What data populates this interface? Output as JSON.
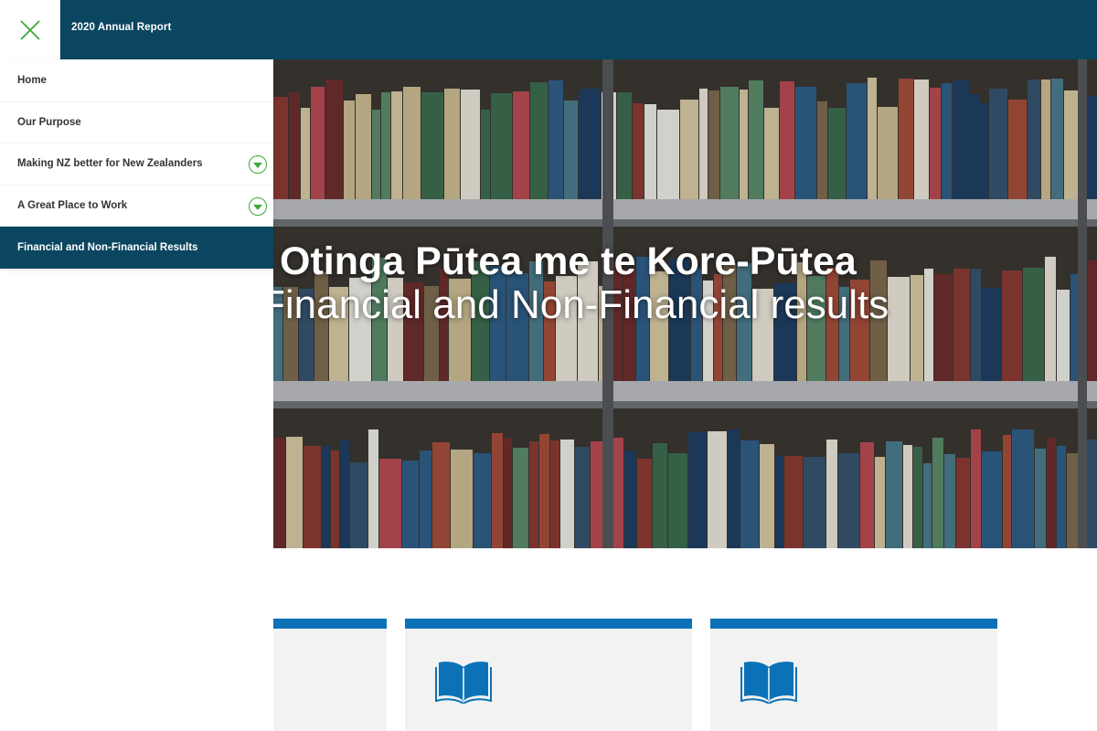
{
  "header": {
    "report_title": "2020 Annual Report"
  },
  "menu": {
    "items": [
      {
        "label": "Home",
        "expandable": false,
        "active": false
      },
      {
        "label": "Our Purpose",
        "expandable": false,
        "active": false
      },
      {
        "label": "Making NZ better for New Zealanders",
        "expandable": true,
        "active": false
      },
      {
        "label": "A Great Place to Work",
        "expandable": true,
        "active": false
      },
      {
        "label": "Financial and Non-Financial Results",
        "expandable": false,
        "active": true
      }
    ]
  },
  "hero": {
    "title_maori": "Otinga Pūtea me te Kore-Pūtea",
    "title_english": "Financial and Non-Financial results"
  },
  "colors": {
    "header_bg": "#0b4660",
    "accent_green": "#3aa935",
    "card_accent_blue": "#0b72b8",
    "card_bg": "#f2f2f2"
  },
  "icons": {
    "close": "close-icon",
    "expand": "chevron-down-icon",
    "card": "open-book-icon"
  }
}
